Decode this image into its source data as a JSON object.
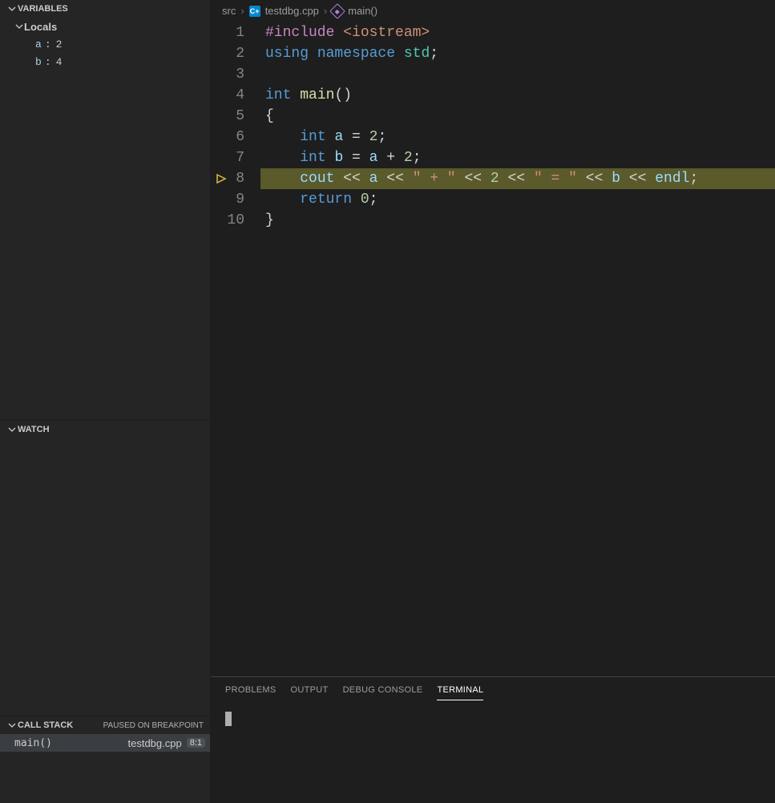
{
  "sidebar": {
    "variables": {
      "title": "VARIABLES",
      "locals_label": "Locals",
      "items": [
        {
          "name": "a",
          "value": "2"
        },
        {
          "name": "b",
          "value": "4"
        }
      ]
    },
    "watch": {
      "title": "WATCH"
    },
    "callstack": {
      "title": "CALL STACK",
      "status": "PAUSED ON BREAKPOINT",
      "frames": [
        {
          "fn": "main()",
          "file": "testdbg.cpp",
          "pos": "8:1"
        }
      ]
    }
  },
  "breadcrumb": {
    "folder": "src",
    "file": "testdbg.cpp",
    "symbol": "main()"
  },
  "editor": {
    "current_line": 8,
    "lines": [
      {
        "n": 1,
        "tokens": [
          [
            "tok-pp",
            "#include "
          ],
          [
            "tok-inc",
            "<iostream>"
          ]
        ]
      },
      {
        "n": 2,
        "tokens": [
          [
            "tok-kw",
            "using "
          ],
          [
            "tok-kw",
            "namespace "
          ],
          [
            "tok-ns",
            "std"
          ],
          [
            "tok-punc",
            ";"
          ]
        ]
      },
      {
        "n": 3,
        "tokens": []
      },
      {
        "n": 4,
        "tokens": [
          [
            "tok-ty",
            "int "
          ],
          [
            "tok-fn",
            "main"
          ],
          [
            "tok-punc",
            "()"
          ]
        ]
      },
      {
        "n": 5,
        "tokens": [
          [
            "tok-punc",
            "{"
          ]
        ]
      },
      {
        "n": 6,
        "tokens": [
          [
            "tok-plain",
            "    "
          ],
          [
            "tok-ty",
            "int "
          ],
          [
            "tok-var",
            "a"
          ],
          [
            "tok-op",
            " = "
          ],
          [
            "tok-num",
            "2"
          ],
          [
            "tok-punc",
            ";"
          ]
        ]
      },
      {
        "n": 7,
        "tokens": [
          [
            "tok-plain",
            "    "
          ],
          [
            "tok-ty",
            "int "
          ],
          [
            "tok-var",
            "b"
          ],
          [
            "tok-op",
            " = "
          ],
          [
            "tok-var",
            "a"
          ],
          [
            "tok-op",
            " + "
          ],
          [
            "tok-num",
            "2"
          ],
          [
            "tok-punc",
            ";"
          ]
        ]
      },
      {
        "n": 8,
        "tokens": [
          [
            "tok-plain",
            "    "
          ],
          [
            "tok-var",
            "cout"
          ],
          [
            "tok-op",
            " << "
          ],
          [
            "tok-var",
            "a"
          ],
          [
            "tok-op",
            " << "
          ],
          [
            "tok-str",
            "\" + \""
          ],
          [
            "tok-op",
            " << "
          ],
          [
            "tok-num",
            "2"
          ],
          [
            "tok-op",
            " << "
          ],
          [
            "tok-str",
            "\" = \""
          ],
          [
            "tok-op",
            " << "
          ],
          [
            "tok-var",
            "b"
          ],
          [
            "tok-op",
            " << "
          ],
          [
            "tok-var",
            "endl"
          ],
          [
            "tok-punc",
            ";"
          ]
        ]
      },
      {
        "n": 9,
        "tokens": [
          [
            "tok-plain",
            "    "
          ],
          [
            "tok-kw",
            "return "
          ],
          [
            "tok-num",
            "0"
          ],
          [
            "tok-punc",
            ";"
          ]
        ]
      },
      {
        "n": 10,
        "tokens": [
          [
            "tok-punc",
            "}"
          ]
        ]
      }
    ]
  },
  "bottom": {
    "tabs": [
      {
        "label": "PROBLEMS",
        "active": false
      },
      {
        "label": "OUTPUT",
        "active": false
      },
      {
        "label": "DEBUG CONSOLE",
        "active": false
      },
      {
        "label": "TERMINAL",
        "active": true
      }
    ]
  }
}
